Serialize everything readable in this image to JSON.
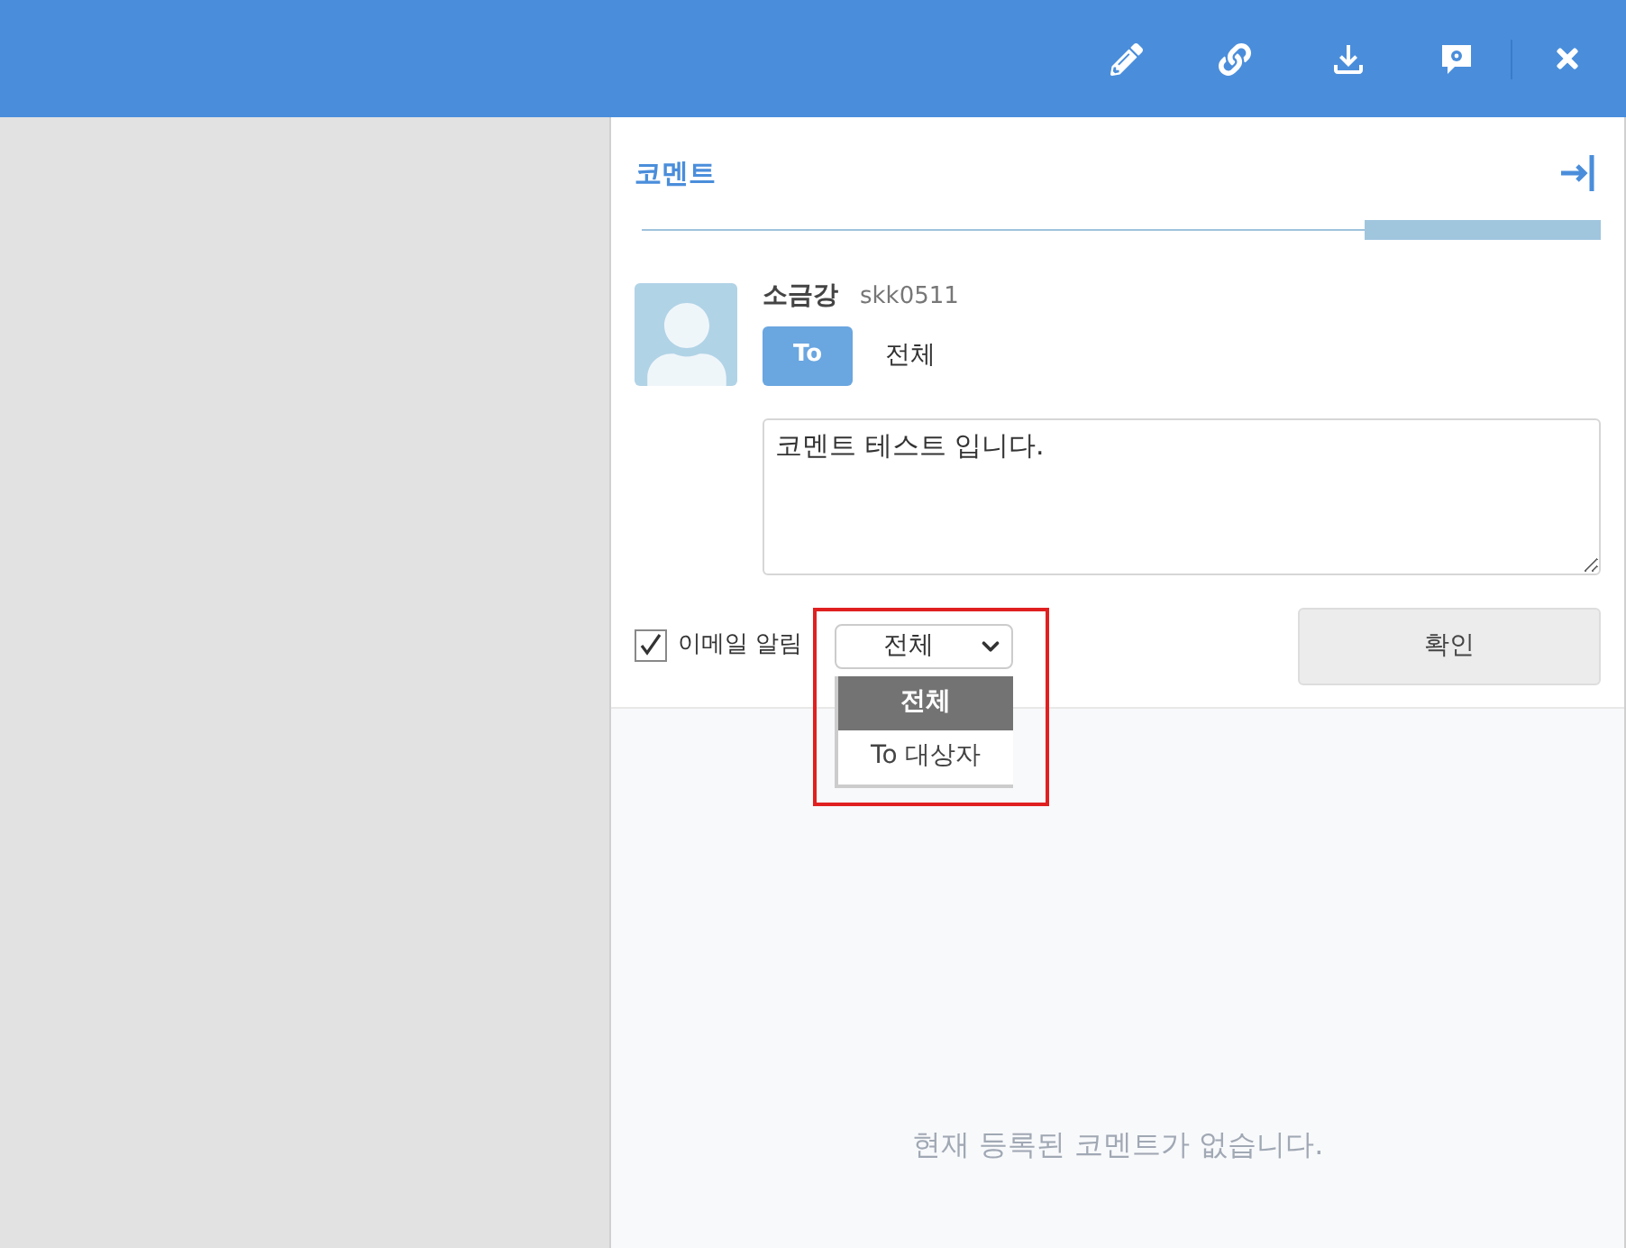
{
  "panel": {
    "title": "코멘트"
  },
  "author": {
    "name": "소금강",
    "id": "skk0511",
    "to_label": "To",
    "recipient": "전체"
  },
  "comment_field": {
    "value": "코멘트 테스트 입니다."
  },
  "email_notify": {
    "label": "이메일 알림",
    "checked": true
  },
  "target_select": {
    "value": "전체",
    "expanded": true,
    "options": [
      {
        "label": "전체",
        "selected": true
      },
      {
        "label": "To 대상자",
        "selected": false
      }
    ]
  },
  "confirm_button": {
    "label": "확인"
  },
  "empty_message": "현재 등록된 코멘트가 없습니다."
}
